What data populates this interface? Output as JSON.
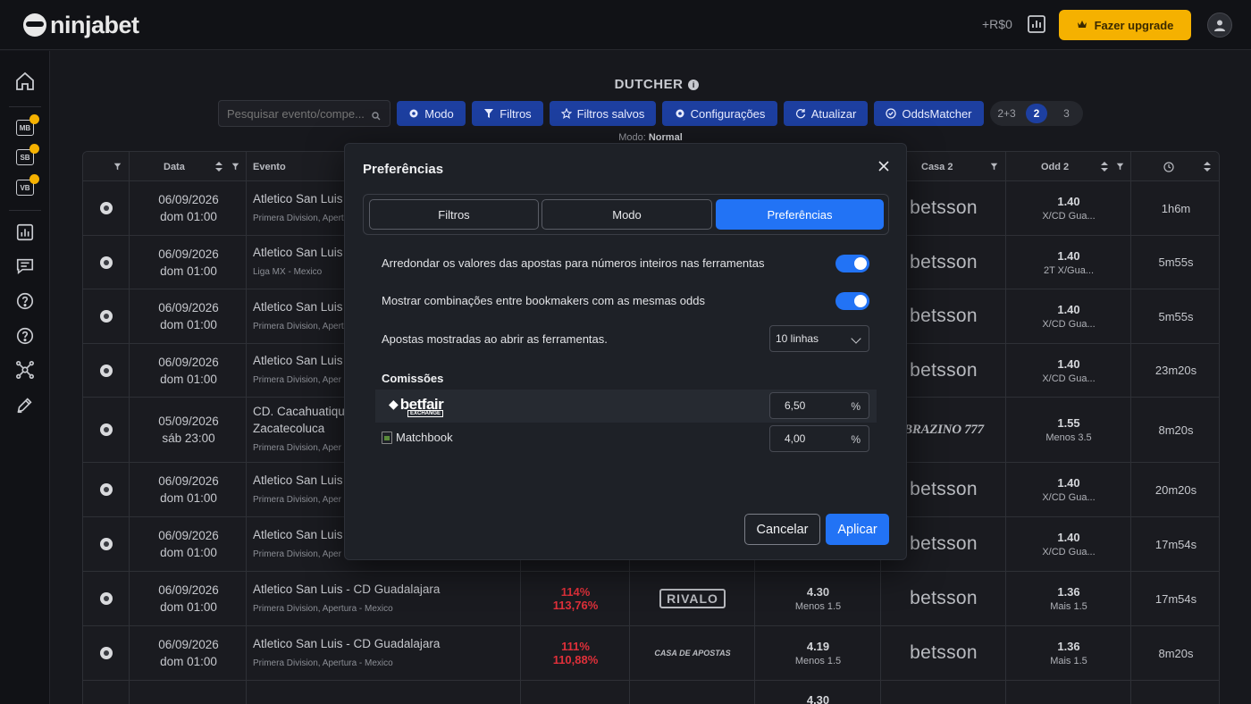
{
  "header": {
    "logo_text": "ninjabet",
    "balance": "+R$0",
    "upgrade_label": "Fazer upgrade"
  },
  "sidebar": {
    "items": [
      {
        "name": "home",
        "icon": "home-icon"
      },
      {
        "name": "mb",
        "badge": "MB"
      },
      {
        "name": "sb",
        "badge": "SB"
      },
      {
        "name": "vb",
        "badge": "VB"
      },
      {
        "name": "reports",
        "icon": "bar-chart-icon"
      },
      {
        "name": "chat",
        "icon": "chat-icon"
      },
      {
        "name": "help",
        "icon": "question-icon"
      },
      {
        "name": "help2",
        "icon": "question-icon"
      },
      {
        "name": "tools",
        "icon": "network-icon"
      },
      {
        "name": "edit",
        "icon": "pen-icon"
      }
    ]
  },
  "page": {
    "title": "DUTCHER",
    "search_placeholder": "Pesquisar evento/compe...",
    "toolbar": {
      "modo": "Modo",
      "filtros": "Filtros",
      "filtros_salvos": "Filtros salvos",
      "configuracoes": "Configurações",
      "atualizar": "Atualizar",
      "oddsmatcher": "OddsMatcher"
    },
    "segments": [
      "2+3",
      "2",
      "3"
    ],
    "modo_label": "Modo:",
    "modo_value": "Normal"
  },
  "table": {
    "headers": {
      "data": "Data",
      "evento": "Evento",
      "casa2": "Casa 2",
      "odd2": "Odd 2"
    },
    "rows": [
      {
        "date": "06/09/2026",
        "time": "dom 01:00",
        "event": "Atletico San Luis -",
        "event2": "",
        "league": "Primera Division, Apertur",
        "pct1": "",
        "pct2": "",
        "bk1": "",
        "odd1": "",
        "odd1_sub": "",
        "bk2": "betsson",
        "odd2": "1.40",
        "odd2_sub": "X/CD Gua...",
        "age": "1h6m"
      },
      {
        "date": "06/09/2026",
        "time": "dom 01:00",
        "event": "Atletico San Luis -",
        "event2": "",
        "league": "Liga MX - Mexico",
        "pct1": "",
        "pct2": "",
        "bk1": "",
        "odd1": "",
        "odd1_sub": "",
        "bk2": "betsson",
        "odd2": "1.40",
        "odd2_sub": "2T X/Gua...",
        "age": "5m55s"
      },
      {
        "date": "06/09/2026",
        "time": "dom 01:00",
        "event": "Atletico San Luis -",
        "event2": "",
        "league": "Primera Division, Apert",
        "pct1": "",
        "pct2": "",
        "bk1": "",
        "odd1": "",
        "odd1_sub": "",
        "bk2": "betsson",
        "odd2": "1.40",
        "odd2_sub": "X/CD Gua...",
        "age": "5m55s"
      },
      {
        "date": "06/09/2026",
        "time": "dom 01:00",
        "event": "Atletico San Luis -",
        "event2": "",
        "league": "Primera Division, Aper",
        "pct1": "",
        "pct2": "",
        "bk1": "",
        "odd1": "",
        "odd1_sub": "",
        "bk2": "betsson",
        "odd2": "1.40",
        "odd2_sub": "X/CD Gua...",
        "age": "23m20s"
      },
      {
        "date": "05/09/2026",
        "time": "sáb 23:00",
        "event": "CD. Cacahuatique",
        "event2": "Zacatecoluca",
        "league": "Primera Division, Aper",
        "pct1": "",
        "pct2": "",
        "bk1": "",
        "odd1": "",
        "odd1_sub": "",
        "bk2": "BRAZINO 777",
        "odd2": "1.55",
        "odd2_sub": "Menos 3.5",
        "age": "8m20s"
      },
      {
        "date": "06/09/2026",
        "time": "dom 01:00",
        "event": "Atletico San Luis -",
        "event2": "",
        "league": "Primera Division, Aper",
        "pct1": "",
        "pct2": "",
        "bk1": "",
        "odd1": "",
        "odd1_sub": "",
        "bk2": "betsson",
        "odd2": "1.40",
        "odd2_sub": "X/CD Gua...",
        "age": "20m20s"
      },
      {
        "date": "06/09/2026",
        "time": "dom 01:00",
        "event": "Atletico San Luis -",
        "event2": "",
        "league": "Primera Division, Aper",
        "pct1": "",
        "pct2": "",
        "bk1": "",
        "odd1": "",
        "odd1_sub": "",
        "bk2": "betsson",
        "odd2": "1.40",
        "odd2_sub": "X/CD Gua...",
        "age": "17m54s"
      },
      {
        "date": "06/09/2026",
        "time": "dom 01:00",
        "event": "Atletico San Luis - CD Guadalajara",
        "event2": "",
        "league": "Primera Division, Apertura - Mexico",
        "pct1": "114%",
        "pct2": "113,76%",
        "bk1": "RIVALO",
        "odd1": "4.30",
        "odd1_sub": "Menos 1.5",
        "bk2": "betsson",
        "odd2": "1.36",
        "odd2_sub": "Mais 1.5",
        "age": "17m54s"
      },
      {
        "date": "06/09/2026",
        "time": "dom 01:00",
        "event": "Atletico San Luis - CD Guadalajara",
        "event2": "",
        "league": "Primera Division, Apertura - Mexico",
        "pct1": "111%",
        "pct2": "110,88%",
        "bk1": "CASA DE APOSTAS",
        "odd1": "4.19",
        "odd1_sub": "Menos 1.5",
        "bk2": "betsson",
        "odd2": "1.36",
        "odd2_sub": "Mais 1.5",
        "age": "8m20s"
      }
    ],
    "partial_row": {
      "odd1": "4.30"
    }
  },
  "modal": {
    "title": "Preferências",
    "tabs": [
      "Filtros",
      "Modo",
      "Preferências"
    ],
    "active_tab": "Preferências",
    "options": {
      "round_label": "Arredondar os valores das apostas para números inteiros nas ferramentas",
      "round_on": true,
      "combo_label": "Mostrar combinações entre bookmakers com as mesmas odds",
      "combo_on": true,
      "lines_label": "Apostas mostradas ao abrir as ferramentas.",
      "lines_value": "10 linhas"
    },
    "commissions_title": "Comissões",
    "commissions": [
      {
        "name": "betfair",
        "sub": "EXCHANGE",
        "value": "6,50",
        "unit": "%"
      },
      {
        "name": "Matchbook",
        "value": "4,00",
        "unit": "%"
      }
    ],
    "cancel_label": "Cancelar",
    "apply_label": "Aplicar"
  },
  "colors": {
    "accent": "#2273f5",
    "toolbar_button": "#1d3fa0",
    "upgrade": "#f5b100",
    "danger": "#e0303a"
  }
}
